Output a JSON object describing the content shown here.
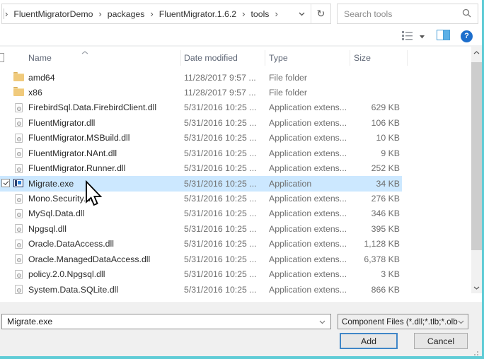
{
  "address_bar": {
    "breadcrumbs": [
      "FluentMigratorDemo",
      "packages",
      "FluentMigrator.1.6.2",
      "tools"
    ],
    "separator": "›",
    "refresh_glyph": "↻"
  },
  "search": {
    "placeholder": "Search tools"
  },
  "toolbar": {
    "help_glyph": "?"
  },
  "file_list": {
    "columns": {
      "name": "Name",
      "date": "Date modified",
      "type": "Type",
      "size": "Size"
    },
    "sort_column": "Name",
    "sort_direction": "ascending",
    "rows": [
      {
        "name": "amd64",
        "date": "11/28/2017 9:57 ...",
        "type": "File folder",
        "size": "",
        "icon": "folder",
        "selected": false,
        "checked": false
      },
      {
        "name": "x86",
        "date": "11/28/2017 9:57 ...",
        "type": "File folder",
        "size": "",
        "icon": "folder",
        "selected": false,
        "checked": false
      },
      {
        "name": "FirebirdSql.Data.FirebirdClient.dll",
        "date": "5/31/2016 10:25 ...",
        "type": "Application extens...",
        "size": "629 KB",
        "icon": "dll",
        "selected": false,
        "checked": false
      },
      {
        "name": "FluentMigrator.dll",
        "date": "5/31/2016 10:25 ...",
        "type": "Application extens...",
        "size": "106 KB",
        "icon": "dll",
        "selected": false,
        "checked": false
      },
      {
        "name": "FluentMigrator.MSBuild.dll",
        "date": "5/31/2016 10:25 ...",
        "type": "Application extens...",
        "size": "10 KB",
        "icon": "dll",
        "selected": false,
        "checked": false
      },
      {
        "name": "FluentMigrator.NAnt.dll",
        "date": "5/31/2016 10:25 ...",
        "type": "Application extens...",
        "size": "9 KB",
        "icon": "dll",
        "selected": false,
        "checked": false
      },
      {
        "name": "FluentMigrator.Runner.dll",
        "date": "5/31/2016 10:25 ...",
        "type": "Application extens...",
        "size": "252 KB",
        "icon": "dll",
        "selected": false,
        "checked": false
      },
      {
        "name": "Migrate.exe",
        "date": "5/31/2016 10:25 ...",
        "type": "Application",
        "size": "34 KB",
        "icon": "exe",
        "selected": true,
        "checked": true
      },
      {
        "name": "Mono.Security.dll",
        "date": "5/31/2016 10:25 ...",
        "type": "Application extens...",
        "size": "276 KB",
        "icon": "dll",
        "selected": false,
        "checked": false
      },
      {
        "name": "MySql.Data.dll",
        "date": "5/31/2016 10:25 ...",
        "type": "Application extens...",
        "size": "346 KB",
        "icon": "dll",
        "selected": false,
        "checked": false
      },
      {
        "name": "Npgsql.dll",
        "date": "5/31/2016 10:25 ...",
        "type": "Application extens...",
        "size": "395 KB",
        "icon": "dll",
        "selected": false,
        "checked": false
      },
      {
        "name": "Oracle.DataAccess.dll",
        "date": "5/31/2016 10:25 ...",
        "type": "Application extens...",
        "size": "1,128 KB",
        "icon": "dll",
        "selected": false,
        "checked": false
      },
      {
        "name": "Oracle.ManagedDataAccess.dll",
        "date": "5/31/2016 10:25 ...",
        "type": "Application extens...",
        "size": "6,378 KB",
        "icon": "dll",
        "selected": false,
        "checked": false
      },
      {
        "name": "policy.2.0.Npgsql.dll",
        "date": "5/31/2016 10:25 ...",
        "type": "Application extens...",
        "size": "3 KB",
        "icon": "dll",
        "selected": false,
        "checked": false
      },
      {
        "name": "System.Data.SQLite.dll",
        "date": "5/31/2016 10:25 ...",
        "type": "Application extens...",
        "size": "866 KB",
        "icon": "dll",
        "selected": false,
        "checked": false
      }
    ]
  },
  "footer": {
    "filename_value": "Migrate.exe",
    "filetype_value": "Component Files (*.dll;*.tlb;*.olb",
    "add_label": "Add",
    "cancel_label": "Cancel"
  },
  "colors": {
    "selection": "#cce8ff",
    "accent_button_border": "#4086c7",
    "help_circle": "#1d6ecc",
    "capture_edge_teal": "#5fccd6",
    "folder_icon": "#f0ca7c"
  }
}
